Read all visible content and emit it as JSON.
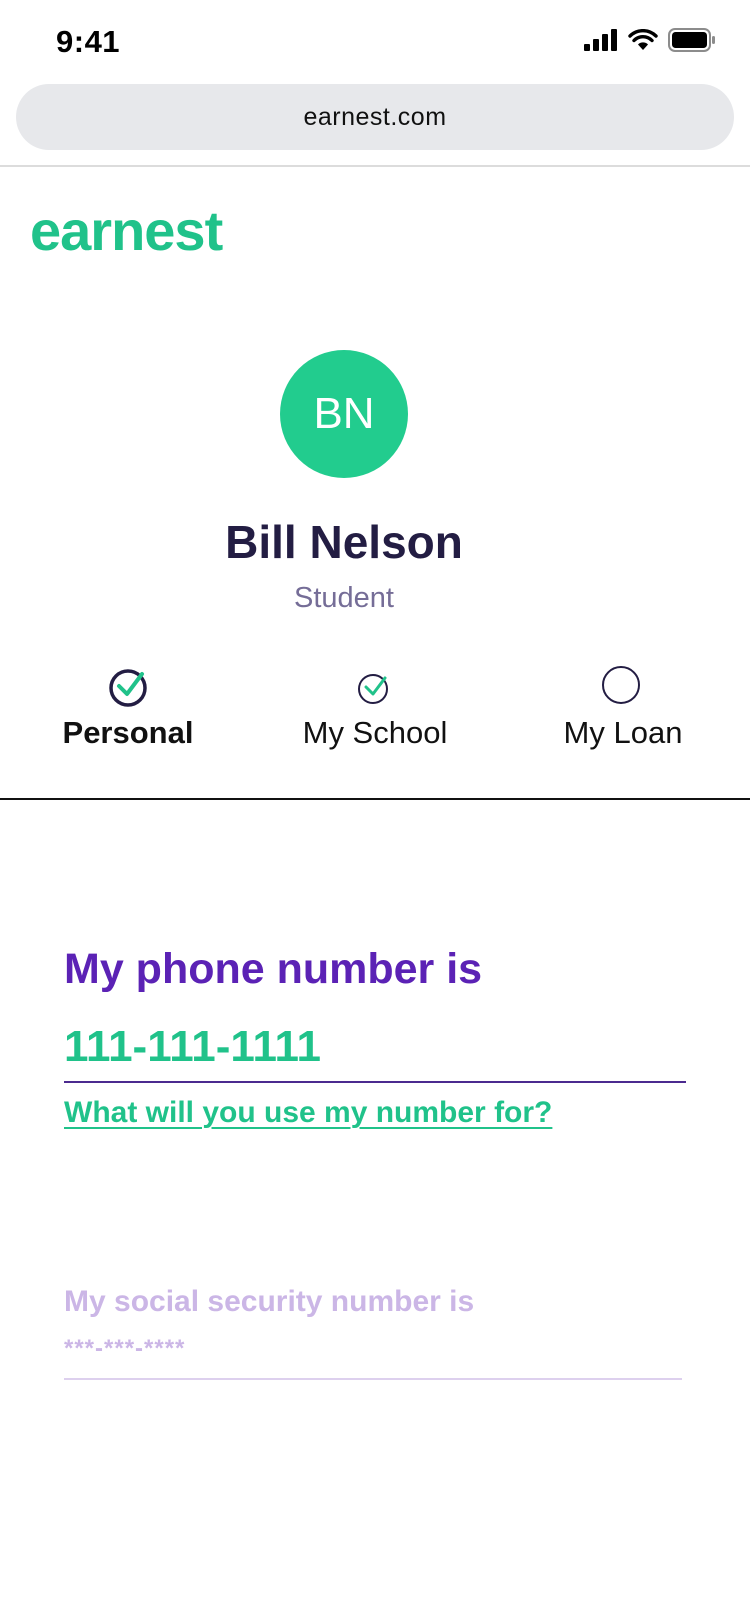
{
  "status_bar": {
    "time": "9:41"
  },
  "browser": {
    "url": "earnest.com"
  },
  "brand": {
    "logo_text": "earnest",
    "color": "#20c28a"
  },
  "profile": {
    "initials": "BN",
    "name": "Bill Nelson",
    "role": "Student"
  },
  "steps": [
    {
      "label": "Personal",
      "state": "complete",
      "active": true
    },
    {
      "label": "My School",
      "state": "complete",
      "active": false
    },
    {
      "label": "My Loan",
      "state": "incomplete",
      "active": false
    }
  ],
  "form": {
    "phone": {
      "question": "My phone number is",
      "value": "111-111-1111",
      "help_link": "What will you use my number for?"
    },
    "ssn": {
      "question": "My social security number is",
      "placeholder": "***-***-****"
    }
  },
  "colors": {
    "accent_purple": "#5b22b5",
    "accent_green": "#20c28a",
    "muted_purple": "#cbb6e6",
    "dark_text": "#231d43"
  }
}
